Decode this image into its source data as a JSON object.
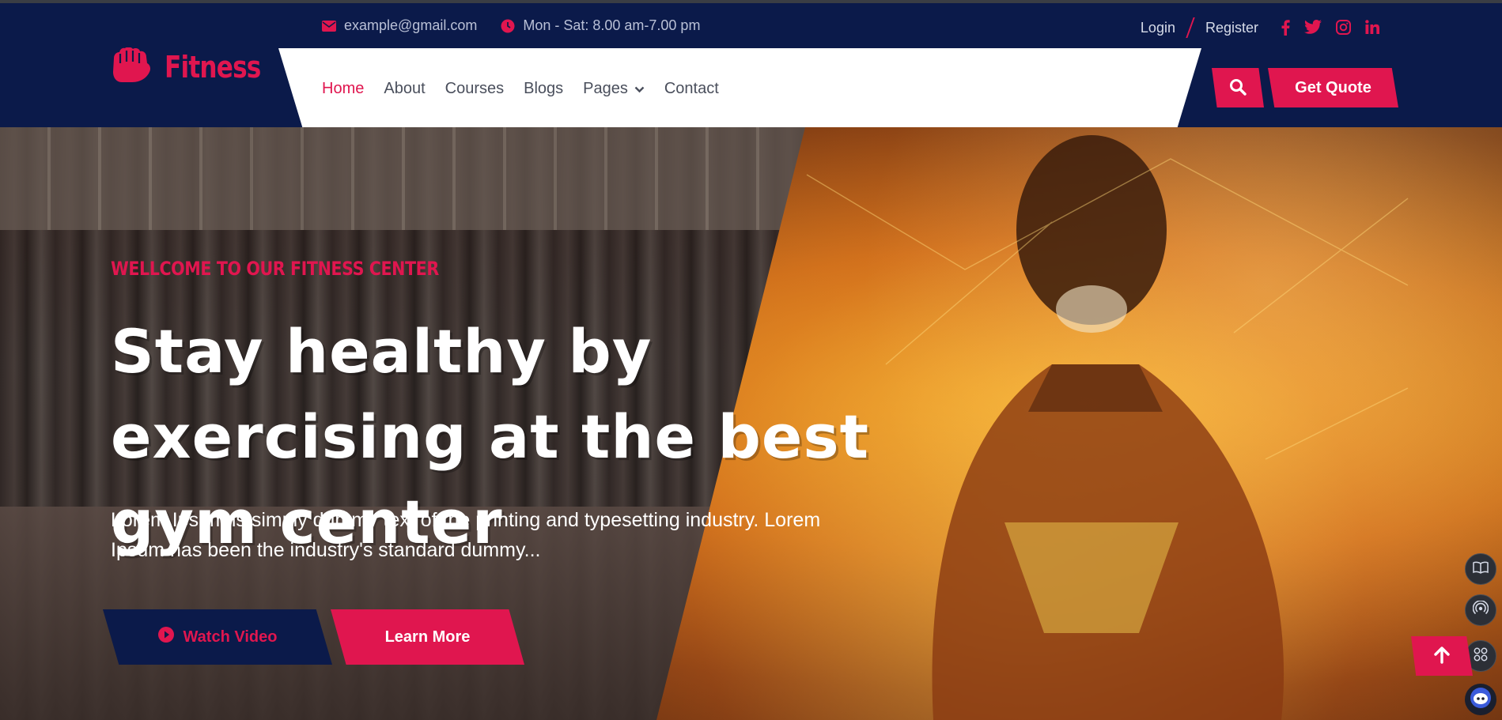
{
  "topbar": {
    "email": "example@gmail.com",
    "hours": "Mon - Sat: 8.00 am-7.00 pm",
    "login": "Login",
    "register": "Register",
    "socials": [
      "facebook-icon",
      "twitter-icon",
      "instagram-icon",
      "linkedin-icon"
    ]
  },
  "brand": {
    "name": "Fitness",
    "icon": "fist-icon"
  },
  "nav": {
    "items": [
      {
        "label": "Home",
        "active": true
      },
      {
        "label": "About"
      },
      {
        "label": "Courses"
      },
      {
        "label": "Blogs"
      },
      {
        "label": "Pages",
        "dropdown": true
      },
      {
        "label": "Contact"
      }
    ],
    "search_icon": "search-icon",
    "quote_label": "Get Quote"
  },
  "hero": {
    "welcome": "WELLCOME TO OUR FITNESS CENTER",
    "headline": "Stay healthy by exercising at the best gym center",
    "description": "Lorem Ipsum is simply dummy text of the printing and typesetting industry. Lorem Ipsum has been the industry's standard dummy...",
    "watch_label": "Watch Video",
    "learn_label": "Learn More"
  },
  "colors": {
    "brand": "#e0164f",
    "navy": "#0b1a4a",
    "white": "#ffffff"
  }
}
